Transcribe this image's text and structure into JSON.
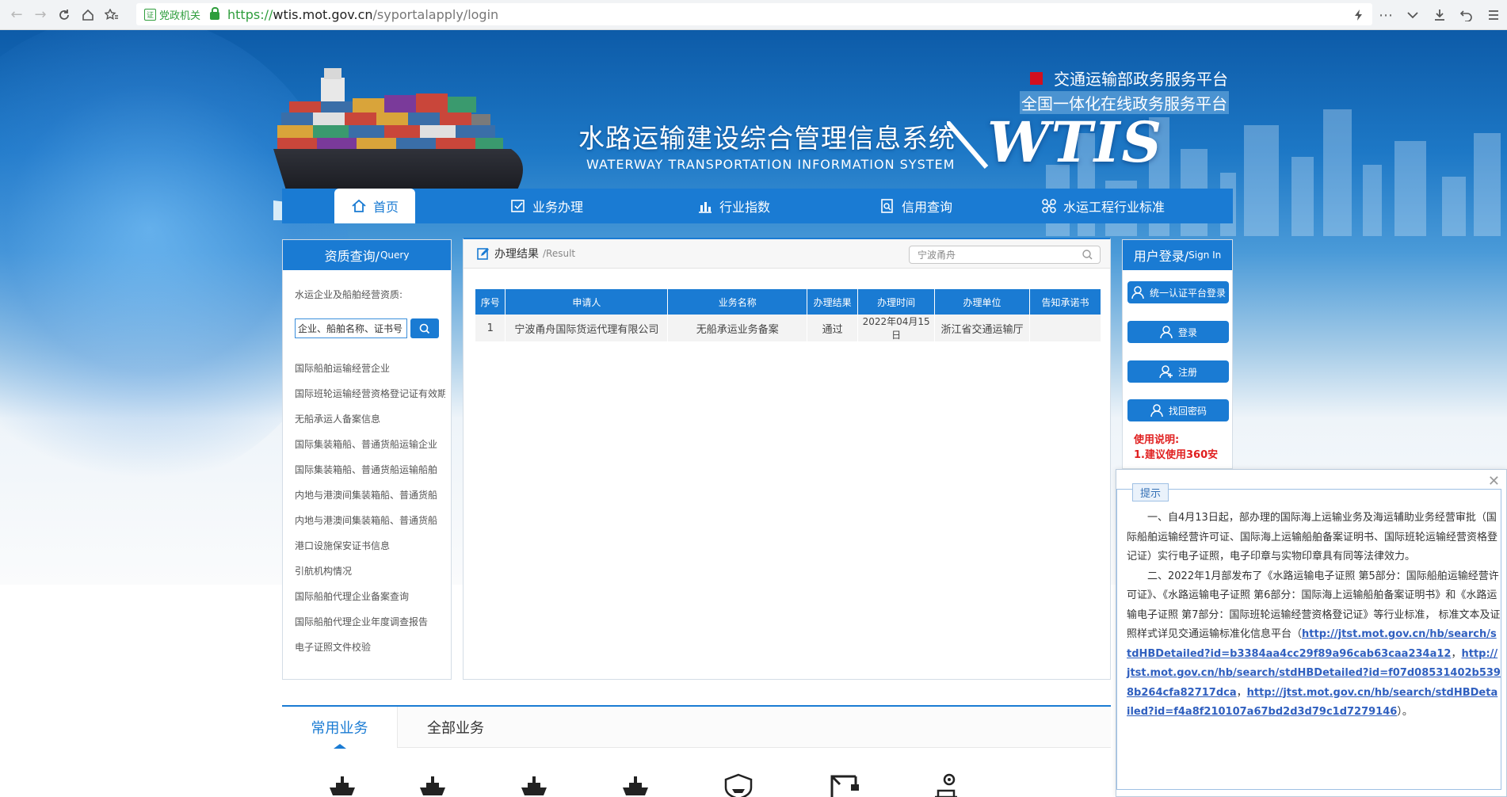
{
  "browser": {
    "gov_badge": "党政机关",
    "url_scheme": "https://",
    "url_host": "wtis.mot.gov.cn",
    "url_path": "/syportalapply/login"
  },
  "banner": {
    "title_cn": "水路运输建设综合管理信息系统",
    "title_en": "WATERWAY TRANSPORTATION INFORMATION SYSTEM",
    "logo": "WTIS",
    "platform1": "交通运输部政务服务平台",
    "platform2": "全国一体化在线政务服务平台"
  },
  "nav": {
    "items": [
      {
        "label": "首页",
        "icon": "home-icon",
        "active": true
      },
      {
        "label": "业务办理",
        "icon": "checkbox-icon"
      },
      {
        "label": "行业指数",
        "icon": "bar-chart-icon"
      },
      {
        "label": "信用查询",
        "icon": "document-search-icon"
      },
      {
        "label": "水运工程行业标准",
        "icon": "standards-icon"
      }
    ]
  },
  "query": {
    "title": "资质查询/",
    "title_en": "Query",
    "subtitle": "水运企业及船舶经营资质:",
    "input_value": "企业、船舶名称、证书号（",
    "links": [
      "国际船舶运输经营企业",
      "国际班轮运输经营资格登记证有效期",
      "无船承运人备案信息",
      "国际集装箱船、普通货船运输企业",
      "国际集装箱船、普通货船运输船舶",
      "内地与港澳间集装箱船、普通货船",
      "内地与港澳间集装箱船、普通货船",
      "港口设施保安证书信息",
      "引航机构情况",
      "国际船舶代理企业备案查询",
      "国际船舶代理企业年度调查报告",
      "电子证照文件校验"
    ]
  },
  "result": {
    "title": "办理结果",
    "title_en": "/Result",
    "search_value": "宁波甬舟",
    "columns": [
      "序号",
      "申请人",
      "业务名称",
      "办理结果",
      "办理时间",
      "办理单位",
      "告知承诺书"
    ],
    "rows": [
      [
        "1",
        "宁波甬舟国际货运代理有限公司",
        "无船承运业务备案",
        "通过",
        "2022年04月15日",
        "浙江省交通运输厅",
        ""
      ]
    ]
  },
  "login": {
    "title": "用户登录/",
    "title_en": "Sign In",
    "buttons": [
      "统一认证平台登录",
      "登录",
      "注册",
      "找回密码"
    ],
    "usage_title": "使用说明:",
    "usage_line1": "1.建议使用360安"
  },
  "tabs": {
    "common": "常用业务",
    "all": "全部业务"
  },
  "popup": {
    "title": "提示",
    "para1": "一、自4月13日起，部办理的国际海上运输业务及海运辅助业务经营审批（国际船舶运输经营许可证、国际海上运输船舶备案证明书、国际班轮运输经营资格登记证）实行电子证照，电子印章与实物印章具有同等法律效力。",
    "para2": "二、2022年1月部发布了《水路运输电子证照 第5部分：国际船舶运输经营许可证》、《水路运输电子证照 第6部分：国际海上运输船舶备案证明书》和《水路运输电子证照 第7部分：国际班轮运输经营资格登记证》等行业标准， 标准文本及证照样式详见交通运输标准化信息平台（",
    "link1": "http://jtst.mot.gov.cn/hb/search/stdHBDetailed?id=b3384aa4cc29f89a96cab63caa234a12",
    "sep1": "，",
    "link2": "http://jtst.mot.gov.cn/hb/search/stdHBDetailed?id=f07d08531402b5398b264cfa82717dca",
    "sep2": "，",
    "link3": "http://jtst.mot.gov.cn/hb/search/stdHBDetailed?id=f4a8f210107a67bd2d3d79c1d7279146",
    "end": "）。"
  }
}
